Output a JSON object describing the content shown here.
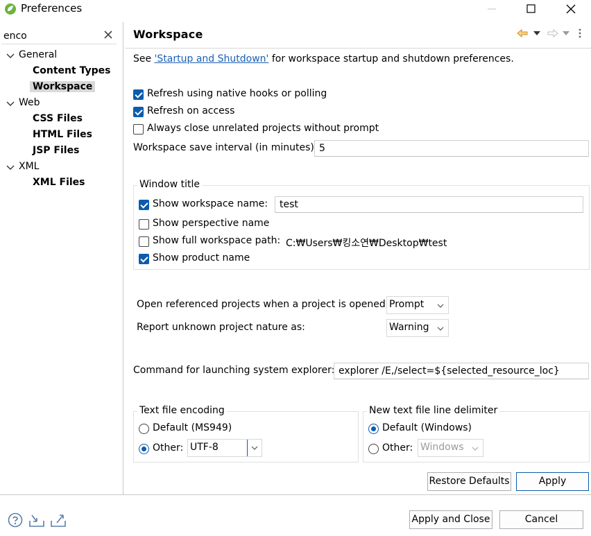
{
  "window": {
    "title": "Preferences",
    "controls": {
      "minimize": "minimize",
      "maximize": "maximize",
      "close": "close"
    }
  },
  "sidebar": {
    "filter_value": "enco",
    "tree": [
      {
        "label": "General",
        "expanded": true,
        "children": [
          {
            "label": "Content Types",
            "selected": false
          },
          {
            "label": "Workspace",
            "selected": true
          }
        ]
      },
      {
        "label": "Web",
        "expanded": true,
        "children": [
          {
            "label": "CSS Files",
            "selected": false
          },
          {
            "label": "HTML Files",
            "selected": false
          },
          {
            "label": "JSP Files",
            "selected": false
          }
        ]
      },
      {
        "label": "XML",
        "expanded": true,
        "children": [
          {
            "label": "XML Files",
            "selected": false
          }
        ]
      }
    ]
  },
  "page": {
    "title": "Workspace",
    "intro_prefix": "See ",
    "intro_link": "'Startup and Shutdown'",
    "intro_suffix": " for workspace startup and shutdown preferences.",
    "options": {
      "refresh_native": {
        "label": "Refresh using native hooks or polling",
        "checked": true
      },
      "refresh_access": {
        "label": "Refresh on access",
        "checked": true
      },
      "close_unrelated": {
        "label": "Always close unrelated projects without prompt",
        "checked": false
      }
    },
    "save_interval": {
      "label": "Workspace save interval (in minutes):",
      "value": "5"
    },
    "window_title": {
      "group_label": "Window title",
      "show_workspace_name": {
        "label": "Show workspace name:",
        "checked": true,
        "value": "test"
      },
      "show_perspective_name": {
        "label": "Show perspective name",
        "checked": false
      },
      "show_full_path": {
        "label": "Show full workspace path:",
        "checked": false,
        "path": "C:₩Users₩킹소연₩Desktop₩test"
      },
      "show_product_name": {
        "label": "Show product name",
        "checked": true
      }
    },
    "open_referenced": {
      "label": "Open referenced projects when a project is opened:",
      "value": "Prompt"
    },
    "unknown_nature": {
      "label": "Report unknown project nature as:",
      "value": "Warning"
    },
    "system_explorer": {
      "label": "Command for launching system explorer:",
      "value": "explorer /E,/select=${selected_resource_loc}"
    },
    "text_encoding": {
      "group_label": "Text file encoding",
      "default_label": "Default (MS949)",
      "other_label": "Other:",
      "selected": "other",
      "other_value": "UTF-8"
    },
    "line_delimiter": {
      "group_label": "New text file line delimiter",
      "default_label": "Default (Windows)",
      "other_label": "Other:",
      "selected": "default",
      "other_value": "Windows"
    },
    "buttons": {
      "restore_defaults": "Restore Defaults",
      "apply": "Apply"
    }
  },
  "footer": {
    "apply_and_close": "Apply and Close",
    "cancel": "Cancel",
    "icons": [
      "help-icon",
      "import-icon",
      "export-icon"
    ]
  },
  "colors": {
    "accent": "#0b5cad",
    "link": "#1a5fb4",
    "nav_arrow": "#e8a33a"
  }
}
